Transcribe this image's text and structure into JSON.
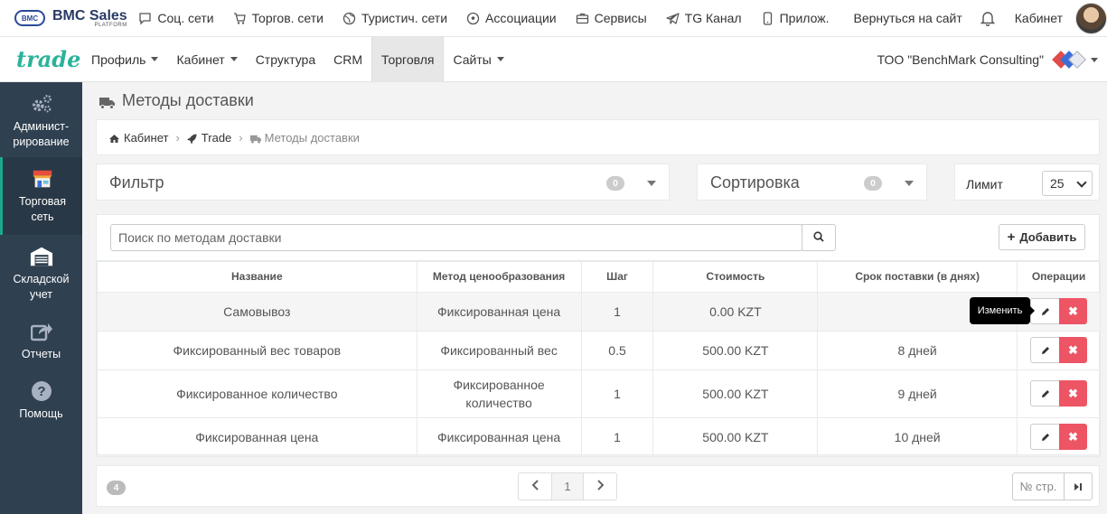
{
  "topbar": {
    "logo_badge": "BMC",
    "logo_name": "BMC Sales",
    "logo_sub": "PLATFORM",
    "nav": [
      {
        "label": "Соц. сети",
        "icon": "chat-icon"
      },
      {
        "label": "Торгов. сети",
        "icon": "cart-icon"
      },
      {
        "label": "Туристич. сети",
        "icon": "globe-icon"
      },
      {
        "label": "Ассоциации",
        "icon": "soccer-icon"
      },
      {
        "label": "Сервисы",
        "icon": "briefcase-icon"
      },
      {
        "label": "TG Канал",
        "icon": "telegram-icon"
      },
      {
        "label": "Прилож.",
        "icon": "mobile-icon"
      }
    ],
    "back_link": "Вернуться на сайт",
    "cabinet_link": "Кабинет"
  },
  "subbar": {
    "brand": "trade",
    "nav": [
      "Профиль",
      "Кабинет",
      "Структура",
      "CRM",
      "Торговля",
      "Сайты"
    ],
    "active": "Торговля",
    "company": "ТОО \"BenchMark Consulting\""
  },
  "sidebar": {
    "items": [
      {
        "label": "Админист-\nрирование",
        "icon": "gears-icon"
      },
      {
        "label": "Торговая\nсеть",
        "icon": "store-icon",
        "active": true
      },
      {
        "label": "Складской\nучет",
        "icon": "warehouse-icon"
      },
      {
        "label": "Отчеты",
        "icon": "share-icon"
      },
      {
        "label": "Помощь",
        "icon": "question-icon"
      }
    ]
  },
  "page": {
    "title": "Методы доставки",
    "breadcrumb": [
      "Кабинет",
      "Trade",
      "Методы доставки"
    ]
  },
  "filter": {
    "title": "Фильтр",
    "count": "0"
  },
  "sort": {
    "title": "Сортировка",
    "count": "0"
  },
  "limit": {
    "label": "Лимит",
    "value": "25"
  },
  "search": {
    "placeholder": "Поиск по методам доставки"
  },
  "add_label": "Добавить",
  "table": {
    "headers": [
      "Название",
      "Метод ценообразования",
      "Шаг",
      "Стоимость",
      "Срок поставки (в днях)",
      "Операции"
    ],
    "rows": [
      {
        "name": "Самовывоз",
        "method": "Фиксированная цена",
        "step": "1",
        "cost": "0.00 KZT",
        "days": ""
      },
      {
        "name": "Фиксированный вес товаров",
        "method": "Фиксированный вес",
        "step": "0.5",
        "cost": "500.00 KZT",
        "days": "8 дней"
      },
      {
        "name": "Фиксированное количество",
        "method": "Фиксированное количество",
        "step": "1",
        "cost": "500.00 KZT",
        "days": "9 дней"
      },
      {
        "name": "Фиксированная цена",
        "method": "Фиксированная цена",
        "step": "1",
        "cost": "500.00 KZT",
        "days": "10 дней"
      }
    ]
  },
  "tooltip": "Изменить",
  "pagination": {
    "total": "4",
    "current": "1",
    "page_input_placeholder": "№ стр."
  },
  "colors": {
    "sidebar": "#2f4050",
    "accent": "#19aa8d",
    "danger": "#ed5565",
    "brand": "#2bb39b"
  }
}
